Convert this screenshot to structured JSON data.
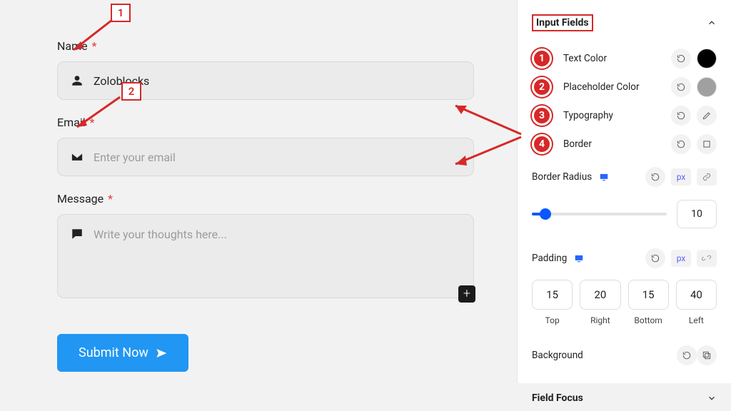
{
  "form": {
    "name": {
      "label": "Name",
      "value": "Zoloblocks"
    },
    "email": {
      "label": "Email",
      "placeholder": "Enter your email"
    },
    "message": {
      "label": "Message",
      "placeholder": "Write your thoughts here..."
    },
    "submit": "Submit Now"
  },
  "sidebar": {
    "section_title": "Input Fields",
    "rows": {
      "text_color": "Text Color",
      "placeholder_color": "Placeholder Color",
      "typography": "Typography",
      "border": "Border",
      "border_radius": "Border Radius",
      "padding": "Padding",
      "background": "Background"
    },
    "border_radius_value": "10",
    "padding_vals": {
      "top": "15",
      "right": "20",
      "bottom": "15",
      "left": "40"
    },
    "padding_labels": {
      "top": "Top",
      "right": "Right",
      "bottom": "Bottom",
      "left": "Left"
    },
    "unit": "px",
    "field_focus": "Field Focus"
  },
  "annotations": {
    "box1": "1",
    "box2": "2",
    "badge1": "1",
    "badge2": "2",
    "badge3": "3",
    "badge4": "4"
  }
}
